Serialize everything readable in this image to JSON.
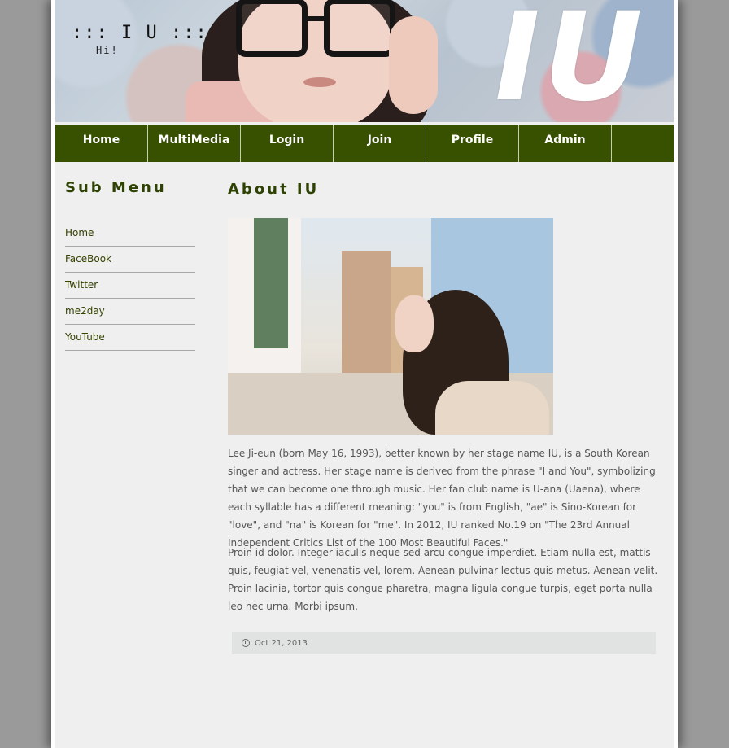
{
  "header": {
    "site_title": "::: I U :::",
    "site_subtitle": "Hi!",
    "banner_logo": "IU"
  },
  "nav": {
    "items": [
      {
        "label": "Home"
      },
      {
        "label": "MultiMedia"
      },
      {
        "label": "Login"
      },
      {
        "label": "Join"
      },
      {
        "label": "Profile"
      },
      {
        "label": "Admin"
      }
    ]
  },
  "sidebar": {
    "title": "Sub Menu",
    "items": [
      {
        "label": "Home"
      },
      {
        "label": "FaceBook"
      },
      {
        "label": "Twitter"
      },
      {
        "label": "me2day"
      },
      {
        "label": "YouTube"
      }
    ]
  },
  "main": {
    "title": "About IU",
    "paragraph1": "Lee Ji-eun (born May 16, 1993), better known by her stage name IU, is a South Korean singer and actress. Her stage name is derived from the phrase \"I and You\", symbolizing that we can become one through music. Her fan club name is U-ana (Uaena), where each syllable has a different meaning: \"you\" is from English, \"ae\" is Sino-Korean for \"love\", and \"na\" is Korean for \"me\". In 2012, IU ranked No.19 on \"The 23rd Annual Independent Critics List of the 100 Most Beautiful Faces.\"",
    "paragraph2": "Proin id dolor. Integer iaculis neque sed arcu congue imperdiet. Etiam nulla est, mattis quis, feugiat vel, venenatis vel, lorem. Aenean pulvinar lectus quis metus. Aenean velit. Proin lacinia, tortor quis congue pharetra, magna ligula congue turpis, eget porta nulla leo nec urna. Morbi ipsum.",
    "date": "Oct 21, 2013",
    "date_icon": "clock-icon"
  },
  "colors": {
    "nav_bg": "#375100",
    "heading": "#2e4204",
    "page_bg": "#efefef"
  }
}
